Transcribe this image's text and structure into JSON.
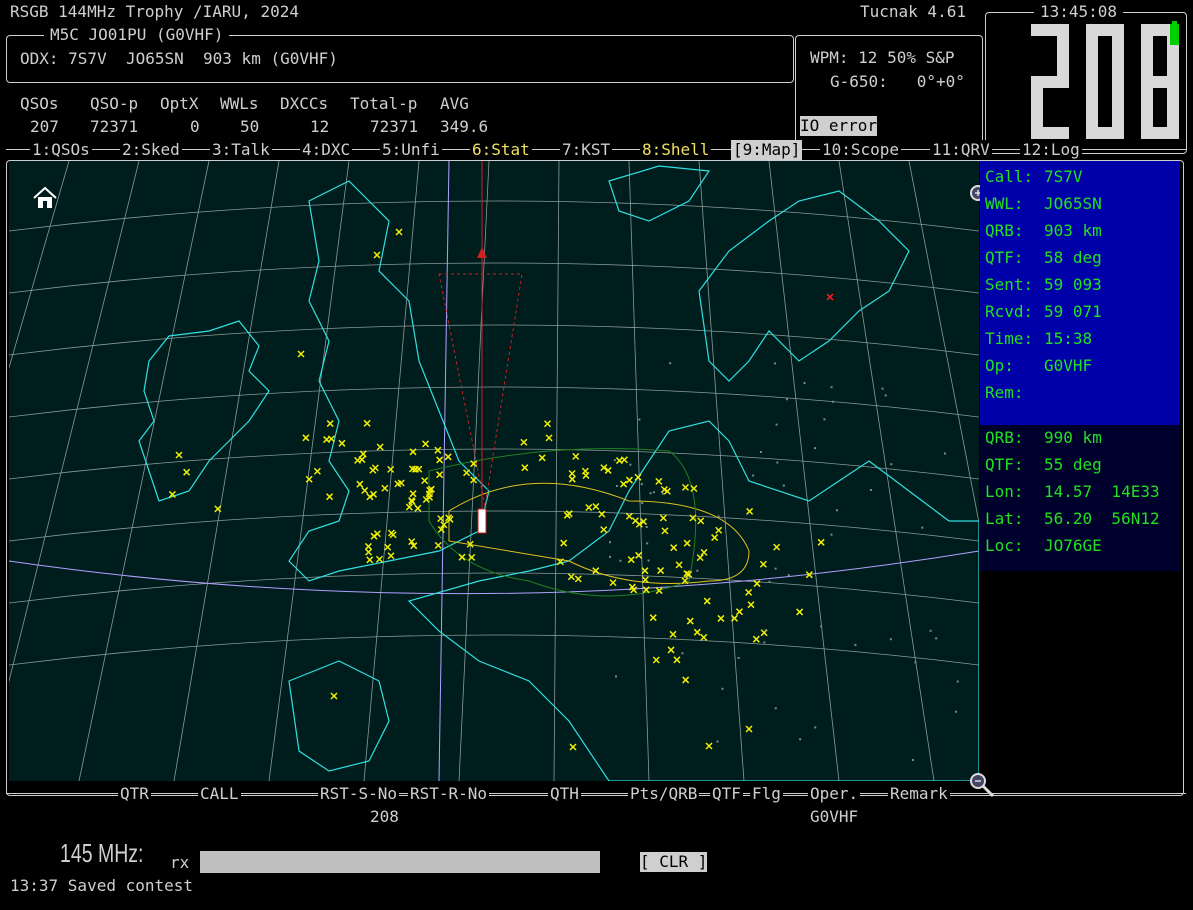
{
  "header": {
    "contest_title": "RSGB 144MHz Trophy /IARU, 2024",
    "app_version": "Tucnak 4.61",
    "clock": "13:45:08"
  },
  "station_panel": {
    "title": "M5C JO01PU (G0VHF)",
    "odx": "ODX: 7S7V  JO65SN  903 km (G0VHF)"
  },
  "stats": {
    "headers": [
      "QSOs",
      "QSO-p",
      "OptX",
      "WWLs",
      "DXCCs",
      "Total-p",
      "AVG"
    ],
    "values": [
      "207",
      "72371",
      "0",
      "50",
      "12",
      "72371",
      "349.6"
    ]
  },
  "cw_panel": {
    "wpm": "WPM: 12 50% S&P",
    "rotor": "G-650:   0°+0°",
    "io_error": "IO error"
  },
  "big_counter": "208",
  "tabs": [
    {
      "label": "1:QSOs"
    },
    {
      "label": "2:Sked"
    },
    {
      "label": "3:Talk"
    },
    {
      "label": "4:DXC"
    },
    {
      "label": "5:Unfi"
    },
    {
      "label": "6:Stat"
    },
    {
      "label": "7:KST"
    },
    {
      "label": "8:Shell"
    },
    {
      "label": "[9:Map]"
    },
    {
      "label": "10:Scope"
    },
    {
      "label": "11:QRV"
    },
    {
      "label": "12:Log"
    }
  ],
  "qso_info": [
    {
      "key": "Call:",
      "value": "7S7V"
    },
    {
      "key": "WWL:",
      "value": "JO65SN"
    },
    {
      "key": "QRB:",
      "value": "903 km"
    },
    {
      "key": "QTF:",
      "value": "58 deg"
    },
    {
      "key": "Sent:",
      "value": "59 093"
    },
    {
      "key": "Rcvd:",
      "value": "59 071"
    },
    {
      "key": "Time:",
      "value": "15:38"
    },
    {
      "key": "Op:",
      "value": "G0VHF"
    },
    {
      "key": "Rem:",
      "value": ""
    }
  ],
  "cursor_info": [
    {
      "key": "QRB:",
      "value": "990 km"
    },
    {
      "key": "QTF:",
      "value": "55 deg"
    },
    {
      "key": "Lon:",
      "value": "14.57  14E33"
    },
    {
      "key": "Lat:",
      "value": "56.20  56N12"
    },
    {
      "key": "Loc:",
      "value": "JO76GE"
    }
  ],
  "entry": {
    "columns": [
      "QTR",
      "CALL",
      "RST-S-No",
      "RST-R-No",
      "QTH",
      "Pts/QRB",
      "QTF",
      "Flg",
      "Oper.",
      "Remark"
    ],
    "serial": "208",
    "operator": "G0VHF",
    "band": "145 MHz:",
    "rx_label": "rx",
    "clr_label": "[ CLR ]",
    "status": "13:37 Saved contest"
  },
  "colors": {
    "background": "#000000",
    "map_bg": "#001d1d",
    "coast": "#30e0e0",
    "qso_marker": "#f0f000",
    "info_bg": "#0000a8",
    "info_text": "#20e020",
    "highlight_tab": "#f0e060"
  }
}
